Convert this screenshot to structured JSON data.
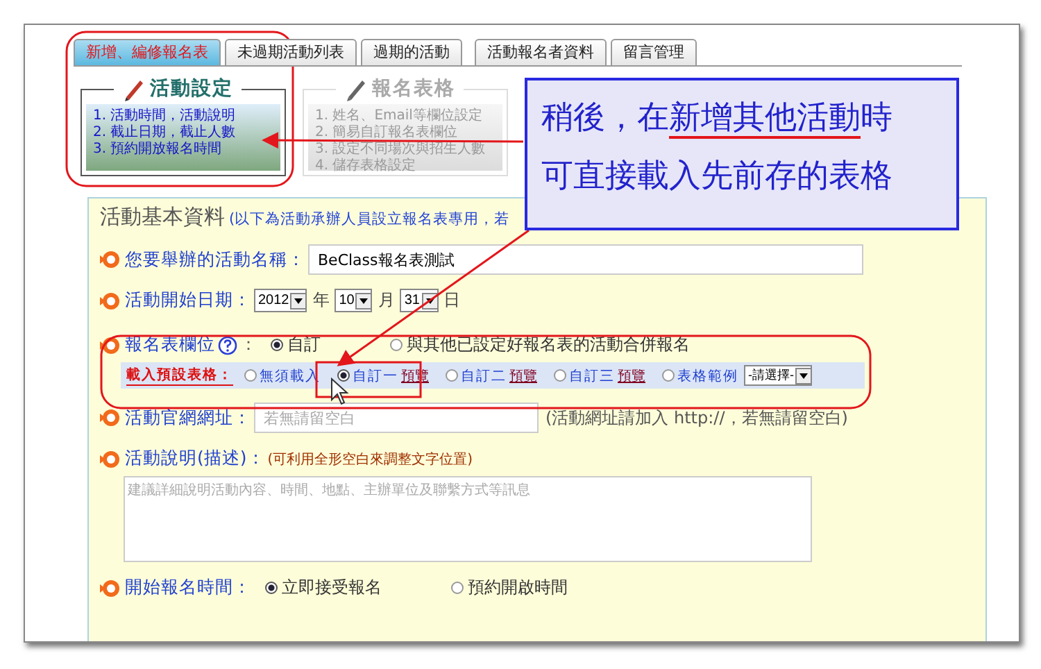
{
  "tabs": [
    {
      "label": "新增、編修報名表",
      "selected": true
    },
    {
      "label": "未過期活動列表",
      "selected": false
    },
    {
      "label": "過期的活動",
      "selected": false
    },
    {
      "label": "活動報名者資料",
      "selected": false
    },
    {
      "label": "留言管理",
      "selected": false
    }
  ],
  "steps": [
    {
      "title": "活動設定",
      "active": true,
      "items": [
        "1. 活動時間，活動說明",
        "2. 截止日期，截止人數",
        "3. 預約開放報名時間"
      ]
    },
    {
      "title": "報名表格",
      "active": false,
      "items": [
        "1. 姓名、Email等欄位設定",
        "2. 簡易自訂報名表欄位",
        "3. 設定不同場次與招生人數",
        "4. 儲存表格設定"
      ]
    }
  ],
  "callout": {
    "lines": [
      [
        {
          "text": "稍後，在",
          "underlined": false
        },
        {
          "text": "新增其他活動",
          "underlined": true
        },
        {
          "text": "時",
          "underlined": false
        }
      ],
      [
        {
          "text": "可直接載入先前存的表格",
          "underlined": false
        }
      ]
    ]
  },
  "form": {
    "title": "活動基本資料",
    "subtitle": "(以下為活動承辦人員設立報名表專用，若",
    "rows": [
      {
        "kind": "text",
        "label": "您要舉辦的活動名稱：",
        "value": "BeClass報名表測試"
      },
      {
        "kind": "date",
        "label": "活動開始日期：",
        "parts": [
          {
            "value": "2012",
            "unit": "年"
          },
          {
            "value": "10",
            "unit": "月"
          },
          {
            "value": "31",
            "unit": "日"
          }
        ]
      },
      {
        "kind": "radio",
        "label": "報名表欄位",
        "help": true,
        "colon": "：",
        "options": [
          {
            "label": "自訂",
            "selected": true
          },
          {
            "label": "與其他已設定好報名表的活動合併報名",
            "selected": false
          }
        ],
        "sub": {
          "label": "載入預設表格：",
          "options": [
            {
              "label": "無須載入",
              "selected": false
            },
            {
              "label": "自訂一",
              "link": "預覽",
              "selected": true
            },
            {
              "label": "自訂二",
              "link": "預覽",
              "selected": false
            },
            {
              "label": "自訂三",
              "link": "預覽",
              "selected": false
            },
            {
              "label": "表格範例",
              "select": "-請選擇-",
              "selected": false
            }
          ]
        }
      },
      {
        "kind": "url",
        "label": "活動官網網址：",
        "placeholder": "若無請留空白",
        "note": "(活動網址請加入 http://，若無請留空白)"
      },
      {
        "kind": "textarea",
        "label": "活動說明(描述)：",
        "note": "(可利用全形空白來調整文字位置)",
        "placeholder": "建議詳細說明活動內容、時間、地點、主辦單位及聯繫方式等訊息"
      },
      {
        "kind": "radio",
        "label": "開始報名時間：",
        "options": [
          {
            "label": "立即接受報名",
            "selected": true
          },
          {
            "label": "預約開啟時間",
            "selected": false
          }
        ]
      }
    ]
  }
}
